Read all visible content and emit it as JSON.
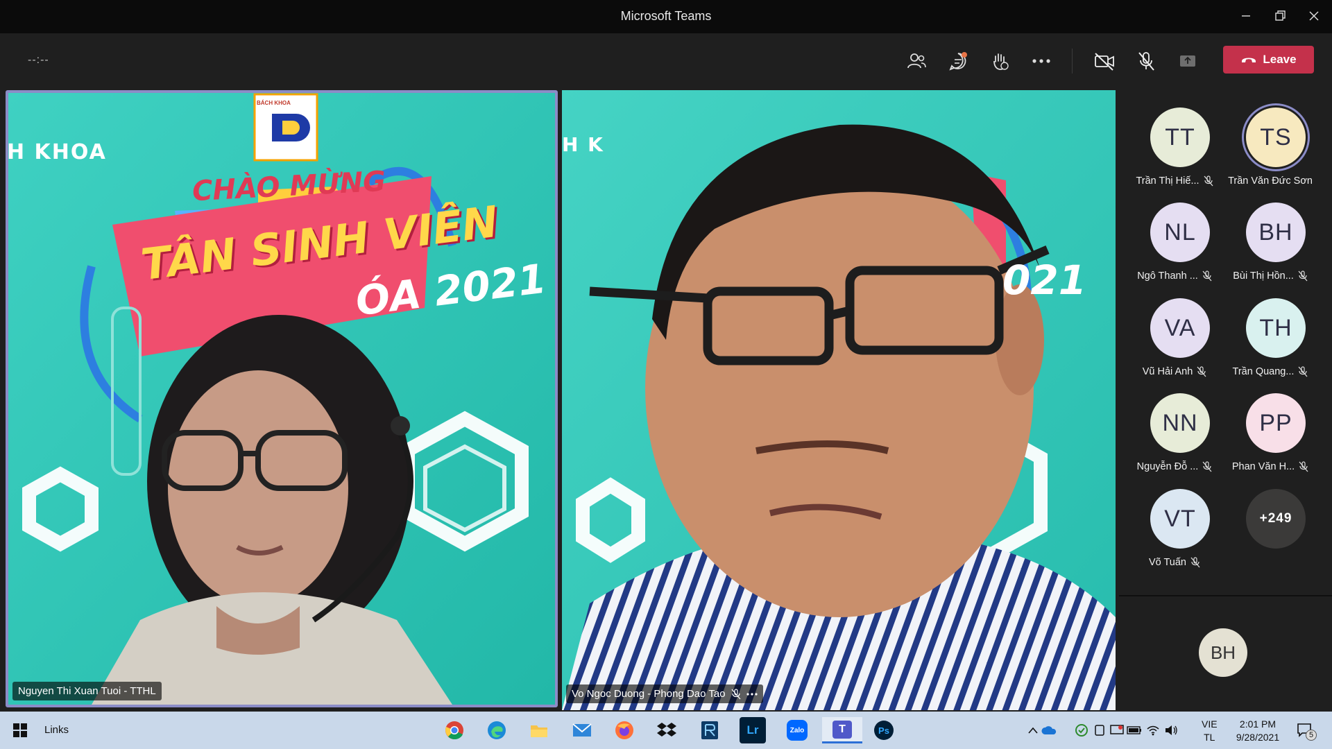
{
  "window": {
    "title": "Microsoft Teams"
  },
  "toolbar": {
    "timer": "--:--",
    "leave_label": "Leave"
  },
  "tiles": [
    {
      "name": "Nguyen Thi Xuan Tuoi - TTHL"
    },
    {
      "name": "Vo Ngoc Duong - Phong Dao Tao"
    }
  ],
  "banner": {
    "school": "H KHOA",
    "logo_text": "BÁCH KHOA",
    "line1": "CHÀO MỪNG",
    "line2": "TÂN SINH VIÊN",
    "line3": "ÓA 2021",
    "right_fragment_top": "H K",
    "right_fragment_year": "021"
  },
  "roster": [
    {
      "initials": "TT",
      "name": "Trần Thị Hiế...",
      "color": "#e7ecd8",
      "muted": true
    },
    {
      "initials": "TS",
      "name": "Trần Văn Đức Sơn",
      "color": "#f7e9bf",
      "muted": false,
      "speaking": true
    },
    {
      "initials": "NL",
      "name": "Ngô Thanh ...",
      "color": "#e5def2",
      "muted": true
    },
    {
      "initials": "BH",
      "name": "Bùi Thị Hồn...",
      "color": "#e5def2",
      "muted": true
    },
    {
      "initials": "VA",
      "name": "Vũ Hải Anh",
      "color": "#e5def2",
      "muted": true
    },
    {
      "initials": "TH",
      "name": "Trần Quang...",
      "color": "#d9f1ef",
      "muted": true
    },
    {
      "initials": "NN",
      "name": "Nguyễn Đỗ ...",
      "color": "#e7ecd8",
      "muted": true
    },
    {
      "initials": "PP",
      "name": "Phan Văn H...",
      "color": "#f8dfe8",
      "muted": true
    },
    {
      "initials": "VT",
      "name": "Võ Tuấn",
      "color": "#dbe7f2",
      "muted": true
    },
    {
      "initials": "+249",
      "name": "",
      "more": true
    }
  ],
  "self": {
    "initials": "BH"
  },
  "taskbar": {
    "links_label": "Links",
    "lang_top": "VIE",
    "lang_bottom": "TL",
    "time": "2:01 PM",
    "date": "9/28/2021",
    "notification_count": "5",
    "apps": [
      "chrome-icon",
      "edge-icon",
      "explorer-icon",
      "mail-icon",
      "firefox-icon",
      "dropbox-icon",
      "app-icon",
      "lightroom-icon",
      "zalo-icon",
      "teams-icon",
      "photoshop-icon"
    ],
    "lr_label": "Lr",
    "zalo_label": "Zalo",
    "ps_label": "Ps",
    "teams_label": "T"
  }
}
